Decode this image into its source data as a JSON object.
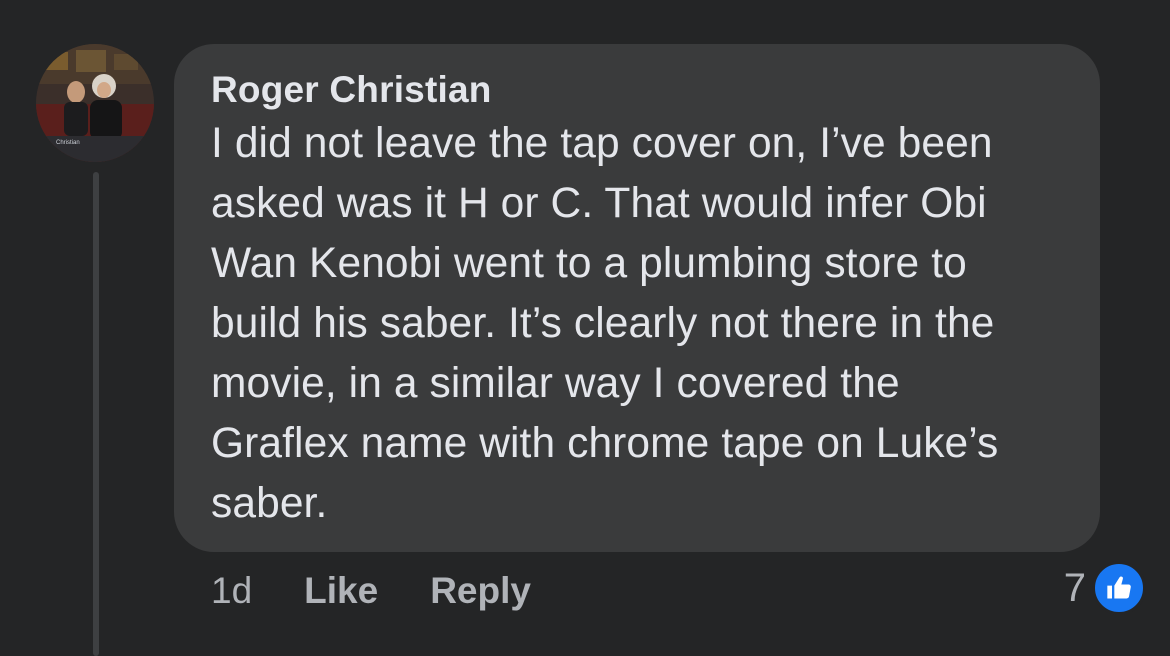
{
  "comment": {
    "author": "Roger Christian",
    "text": "I did not leave the tap cover on, I’ve been\nasked was it H or C. That would infer Obi\nWan Kenobi went to a plumbing store to\nbuild his saber. It’s clearly not there in the\nmovie, in a similar way I covered the\nGraflex name with chrome tape on Luke’s\nsaber.",
    "avatar_caption": "Christian"
  },
  "actions": {
    "timestamp": "1d",
    "like_label": "Like",
    "reply_label": "Reply"
  },
  "reactions": {
    "count": "7",
    "icon": "thumbs-up-icon",
    "color": "#1877f2"
  },
  "colors": {
    "background": "#242526",
    "bubble": "#3a3b3c",
    "primary_text": "#e4e6eb",
    "secondary_text": "#b0b3b8"
  }
}
